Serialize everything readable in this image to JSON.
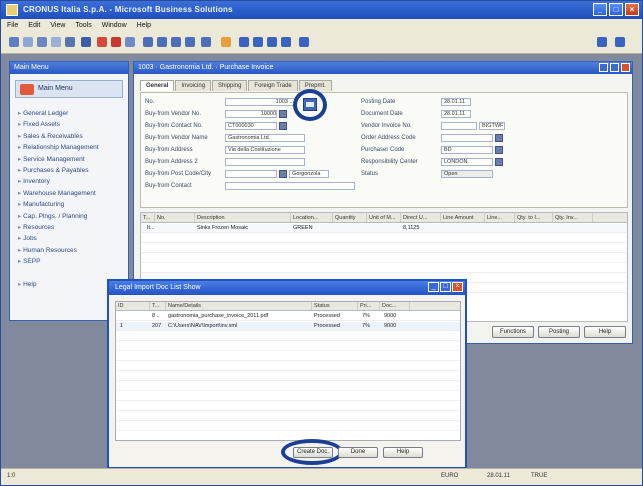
{
  "app": {
    "title": "CRONUS Italia S.p.A. - Microsoft Business Solutions",
    "menu": [
      "File",
      "Edit",
      "View",
      "Tools",
      "Window",
      "Help"
    ]
  },
  "main_menu": {
    "title": "Main Menu",
    "header": "Main Menu",
    "items": [
      "General Ledger",
      "Fixed Assets",
      "Sales & Receivables",
      "Relationship Management",
      "Service Management",
      "Purchases & Payables",
      "Inventory",
      "Warehouse Management",
      "Manufacturing",
      "Cap. Plngs. / Planning",
      "Resources",
      "Jobs",
      "Human Resources",
      "SEPP",
      "",
      "Help"
    ]
  },
  "document": {
    "title": "1003 · Gastronomia Ltd. · Purchase Invoice",
    "tabs": [
      "General",
      "Invoicing",
      "Shipping",
      "Foreign Trade",
      "Prepmt."
    ],
    "left_fields": [
      {
        "label": "No.",
        "value": "1003 ..."
      },
      {
        "label": "Buy-from Vendor No.",
        "value": "10000"
      },
      {
        "label": "Buy-from Contact No.",
        "value": "CT000030"
      },
      {
        "label": "Buy-from Vendor Name",
        "value": "Gastronomia Ltd."
      },
      {
        "label": "Buy-from Address",
        "value": "Via della Costituzione"
      },
      {
        "label": "Buy-from Address 2",
        "value": ""
      },
      {
        "label": "Buy-from Post Code/City",
        "value": ""
      },
      {
        "label": "Buy-from Contact",
        "value": ""
      }
    ],
    "city_value": "Gorgonzola",
    "right_fields": [
      {
        "label": "Posting Date",
        "value": "28.01.11"
      },
      {
        "label": "Document Date",
        "value": "28.01.11"
      },
      {
        "label": "Vendor Invoice No.",
        "value": ""
      },
      {
        "label": "Order Address Code",
        "value": ""
      },
      {
        "label": "Purchaser Code",
        "value": "BD"
      },
      {
        "label": "Responsibility Center",
        "value": "LONDON"
      },
      {
        "label": "Status",
        "value": "Open"
      }
    ],
    "vendor_invoice_extra": "BIGTWF",
    "lines": {
      "columns": [
        "T...",
        "No.",
        "Description",
        "Location...",
        "Quantity",
        "Unit of M...",
        "Direct U...",
        "Line Amount",
        "Line...",
        "Qty. to I...",
        "Qty. Inv..."
      ],
      "rows": [
        {
          "type": "It...",
          "no": "",
          "description": "Sinks Frozen Mosaic",
          "location": "GREEN",
          "quantity": "",
          "uom": "",
          "direct": "8,1125"
        }
      ]
    },
    "buttons": [
      "Functions",
      "Posting",
      "Help"
    ]
  },
  "dialog": {
    "title": "Legal Import Doc List Show",
    "columns": [
      "ID",
      "T...",
      "Name/Details",
      "Status",
      "Pri...",
      "Doc..."
    ],
    "rows": [
      {
        "id": "",
        "t": "8 ..",
        "name": "gastronomia_purchase_invoice_2011.pdf",
        "status": "Processed",
        "pri": "7%",
        "doc": "9000"
      },
      {
        "id": "1",
        "t": "207",
        "name": "C:\\Users\\NAV\\Import\\inv.xml",
        "status": "Processed",
        "pri": "7%",
        "doc": "9000"
      }
    ],
    "buttons": [
      "Create Doc.",
      "Done",
      "Help"
    ]
  },
  "status_bar": {
    "left": "1:0",
    "items": [
      "EURO",
      "28.01.11",
      "TRUE"
    ]
  }
}
